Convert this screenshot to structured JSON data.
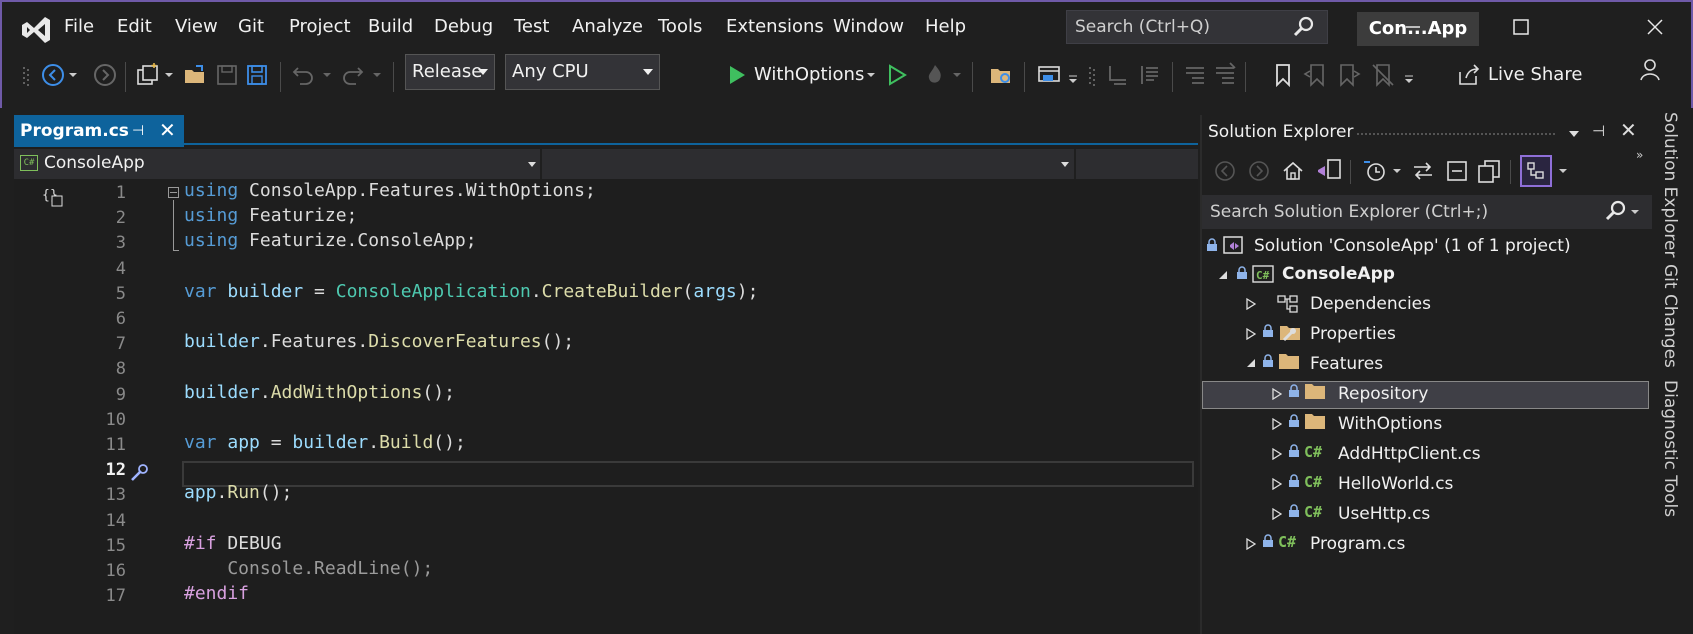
{
  "menu": {
    "items": [
      "File",
      "Edit",
      "View",
      "Git",
      "Project",
      "Build",
      "Debug",
      "Test",
      "Analyze",
      "Tools",
      "Extensions",
      "Window",
      "Help"
    ],
    "search_placeholder": "Search (Ctrl+Q)",
    "solution_name": "Con...App"
  },
  "toolbar": {
    "configuration": "Release",
    "platform": "Any CPU",
    "run_target": "WithOptions",
    "live_share": "Live Share"
  },
  "editor": {
    "tab_title": "Program.cs",
    "nav_project": "ConsoleApp",
    "current_line": "12",
    "line_numbers": [
      "1",
      "2",
      "3",
      "4",
      "5",
      "6",
      "7",
      "8",
      "9",
      "10",
      "11",
      "12",
      "13",
      "14",
      "15",
      "16",
      "17"
    ],
    "lines": [
      [
        [
          "kw",
          "using"
        ],
        [
          "pl",
          " ConsoleApp.Features.WithOptions;"
        ]
      ],
      [
        [
          "kw",
          "using"
        ],
        [
          "pl",
          " Featurize;"
        ]
      ],
      [
        [
          "kw",
          "using"
        ],
        [
          "pl",
          " Featurize.ConsoleApp;"
        ]
      ],
      [],
      [
        [
          "kw",
          "var"
        ],
        [
          "pl",
          " "
        ],
        [
          "var",
          "builder"
        ],
        [
          "pl",
          " = "
        ],
        [
          "ty",
          "ConsoleApplication"
        ],
        [
          "pl",
          "."
        ],
        [
          "fn",
          "CreateBuilder"
        ],
        [
          "pl",
          "("
        ],
        [
          "prm",
          "args"
        ],
        [
          "pl",
          ");"
        ]
      ],
      [],
      [
        [
          "var",
          "builder"
        ],
        [
          "pl",
          ".Features."
        ],
        [
          "fn",
          "DiscoverFeatures"
        ],
        [
          "pl",
          "();"
        ]
      ],
      [],
      [
        [
          "var",
          "builder"
        ],
        [
          "pl",
          "."
        ],
        [
          "fn",
          "AddWithOptions"
        ],
        [
          "pl",
          "();"
        ]
      ],
      [],
      [
        [
          "kw",
          "var"
        ],
        [
          "pl",
          " "
        ],
        [
          "var",
          "app"
        ],
        [
          "pl",
          " = "
        ],
        [
          "var",
          "builder"
        ],
        [
          "pl",
          "."
        ],
        [
          "fn",
          "Build"
        ],
        [
          "pl",
          "();"
        ]
      ],
      [],
      [
        [
          "var",
          "app"
        ],
        [
          "pl",
          "."
        ],
        [
          "fn",
          "Run"
        ],
        [
          "pl",
          "();"
        ]
      ],
      [],
      [
        [
          "kw2",
          "#if"
        ],
        [
          "pl",
          " DEBUG"
        ]
      ],
      [
        [
          "gray",
          "    Console.ReadLine();"
        ]
      ],
      [
        [
          "kw2",
          "#endif"
        ]
      ]
    ]
  },
  "solution_explorer": {
    "title": "Solution Explorer",
    "search_placeholder": "Search Solution Explorer (Ctrl+;)",
    "solution_label": "Solution 'ConsoleApp' (1 of 1 project)",
    "project_label": "ConsoleApp",
    "items": {
      "dependencies": "Dependencies",
      "properties": "Properties",
      "features": "Features",
      "repository": "Repository",
      "withoptions": "WithOptions",
      "addhttpclient": "AddHttpClient.cs",
      "helloworld": "HelloWorld.cs",
      "usehttp": "UseHttp.cs",
      "program": "Program.cs"
    },
    "cs_badge": "C#"
  },
  "side_tabs": [
    "Solution Explorer",
    "Git Changes",
    "Diagnostic Tools"
  ],
  "colors": {
    "accent": "#0e639c",
    "frame": "#6f5aa8",
    "keyword": "#569cd6",
    "type": "#4ec9b0",
    "method": "#dcdcaa",
    "variable": "#9cdcfe",
    "preprocessor": "#d8a0df",
    "run_green": "#3fbf5f"
  }
}
